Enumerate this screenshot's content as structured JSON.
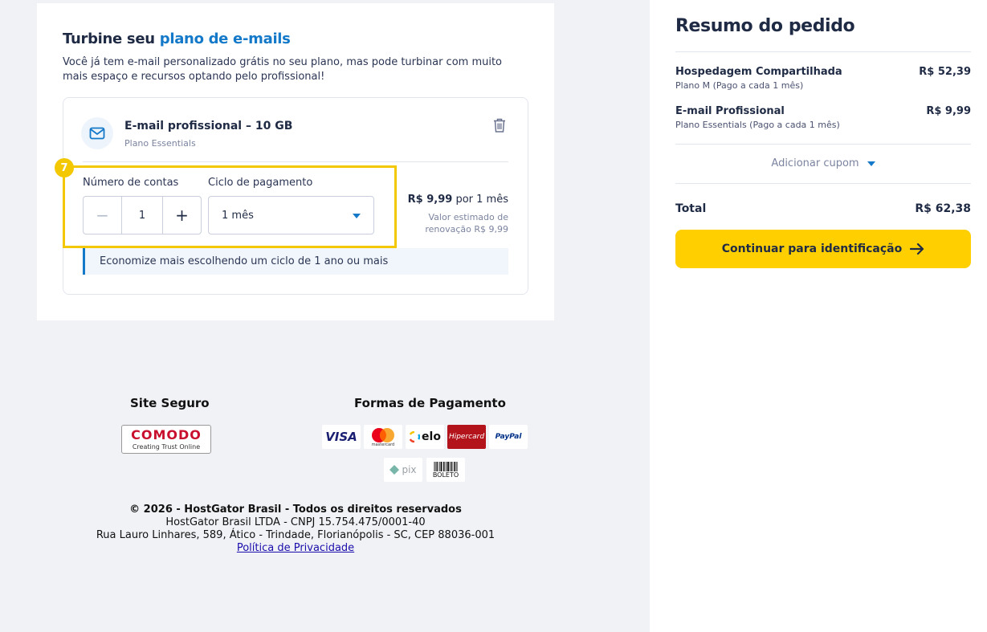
{
  "upsell": {
    "title_prefix": "Turbine seu",
    "title_accent": "plano de e-mails",
    "description": "Você já tem e-mail personalizado grátis no seu plano, mas pode turbinar com muito mais espaço e recursos optando pelo profissional!",
    "product_name": "E-mail profissional – 10 GB",
    "product_plan": "Plano Essentials",
    "step_number": "7",
    "accounts_label": "Número de contas",
    "accounts_value": "1",
    "cycle_label": "Ciclo de pagamento",
    "cycle_value": "1 mês",
    "price_value": "R$ 9,99",
    "price_period": "por 1 mês",
    "renewal_note": "Valor estimado de renovação R$ 9,99",
    "tip": "Economize mais escolhendo um ciclo de 1 ano ou mais"
  },
  "footer": {
    "secure_title": "Site Seguro",
    "comodo_brand": "COMODO",
    "comodo_tagline": "Creating Trust Online",
    "payment_title": "Formas de Pagamento",
    "payment_methods": [
      "VISA",
      "mastercard",
      "elo",
      "Hipercard",
      "PayPal",
      "pix",
      "BOLETO"
    ],
    "copyright": "© 2026 - HostGator Brasil - Todos os direitos reservados",
    "company": "HostGator Brasil LTDA - CNPJ 15.754.475/0001-40",
    "address": "Rua Lauro Linhares, 589, Ático - Trindade, Florianópolis - SC, CEP 88036-001",
    "privacy_link": "Política de Privacidade"
  },
  "summary": {
    "title": "Resumo do pedido",
    "items": [
      {
        "name": "Hospedagem Compartilhada",
        "sub": "Plano M (Pago a cada 1 mês)",
        "price": "R$ 52,39"
      },
      {
        "name": "E-mail Profissional",
        "sub": "Plano Essentials (Pago a cada 1 mês)",
        "price": "R$ 9,99"
      }
    ],
    "coupon_label": "Adicionar cupom",
    "total_label": "Total",
    "total_value": "R$ 62,38",
    "cta_label": "Continuar para identificação"
  },
  "colors": {
    "accent_blue": "#1479c9",
    "cta_yellow": "#ffcf00",
    "highlight_yellow": "#f3c800",
    "text_dark": "#1f2a44"
  }
}
